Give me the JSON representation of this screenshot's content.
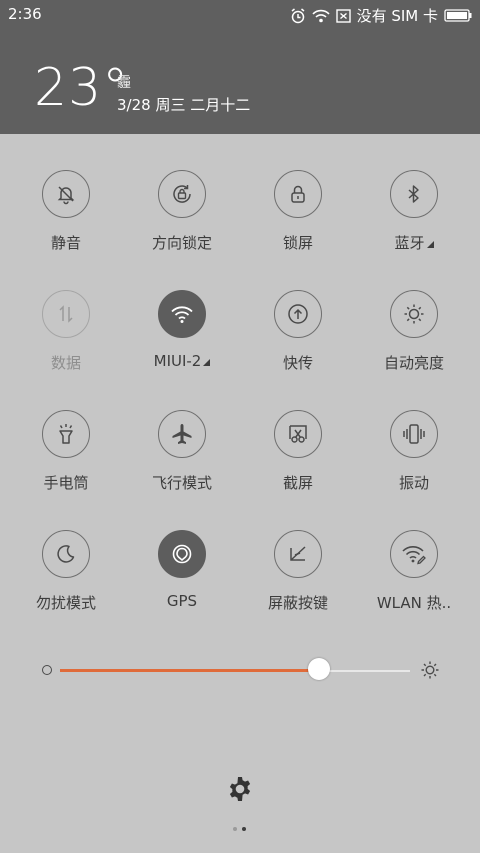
{
  "status_bar": {
    "time": "2:36",
    "carrier": "没有 SIM 卡",
    "icons": [
      "alarm-icon",
      "wifi-icon",
      "no-sim-icon",
      "battery-icon"
    ]
  },
  "weather": {
    "temperature": "23°",
    "condition": "霾",
    "date": "3/28 周三 二月十二"
  },
  "toggles": [
    {
      "label": "静音",
      "icon": "mute-bell-icon",
      "state": "off"
    },
    {
      "label": "方向锁定",
      "icon": "rotation-lock-icon",
      "state": "off"
    },
    {
      "label": "锁屏",
      "icon": "lock-icon",
      "state": "off"
    },
    {
      "label": "蓝牙",
      "icon": "bluetooth-icon",
      "state": "off",
      "has_menu": true
    },
    {
      "label": "数据",
      "icon": "data-arrows-icon",
      "state": "disabled"
    },
    {
      "label": "MIUI-2",
      "icon": "wifi-icon",
      "state": "on",
      "has_menu": true
    },
    {
      "label": "快传",
      "icon": "quick-transfer-icon",
      "state": "off"
    },
    {
      "label": "自动亮度",
      "icon": "auto-brightness-icon",
      "state": "off"
    },
    {
      "label": "手电筒",
      "icon": "flashlight-icon",
      "state": "off"
    },
    {
      "label": "飞行模式",
      "icon": "airplane-icon",
      "state": "off"
    },
    {
      "label": "截屏",
      "icon": "screenshot-scissors-icon",
      "state": "off"
    },
    {
      "label": "振动",
      "icon": "vibrate-icon",
      "state": "off"
    },
    {
      "label": "勿扰模式",
      "icon": "moon-icon",
      "state": "off"
    },
    {
      "label": "GPS",
      "icon": "gps-icon",
      "state": "on"
    },
    {
      "label": "屏蔽按键",
      "icon": "block-keys-icon",
      "state": "off"
    },
    {
      "label": "WLAN 热..",
      "icon": "wlan-hotspot-icon",
      "state": "off"
    }
  ],
  "brightness": {
    "level": 0.74,
    "accent": "#e06b3a"
  },
  "footer": {
    "settings_icon": "gear-icon",
    "page_count": 2,
    "current_page": 2
  },
  "colors": {
    "header_bg": "#5f5f5f",
    "panel_bg": "#c6c6c6",
    "active_circle": "#5d5d5d"
  }
}
